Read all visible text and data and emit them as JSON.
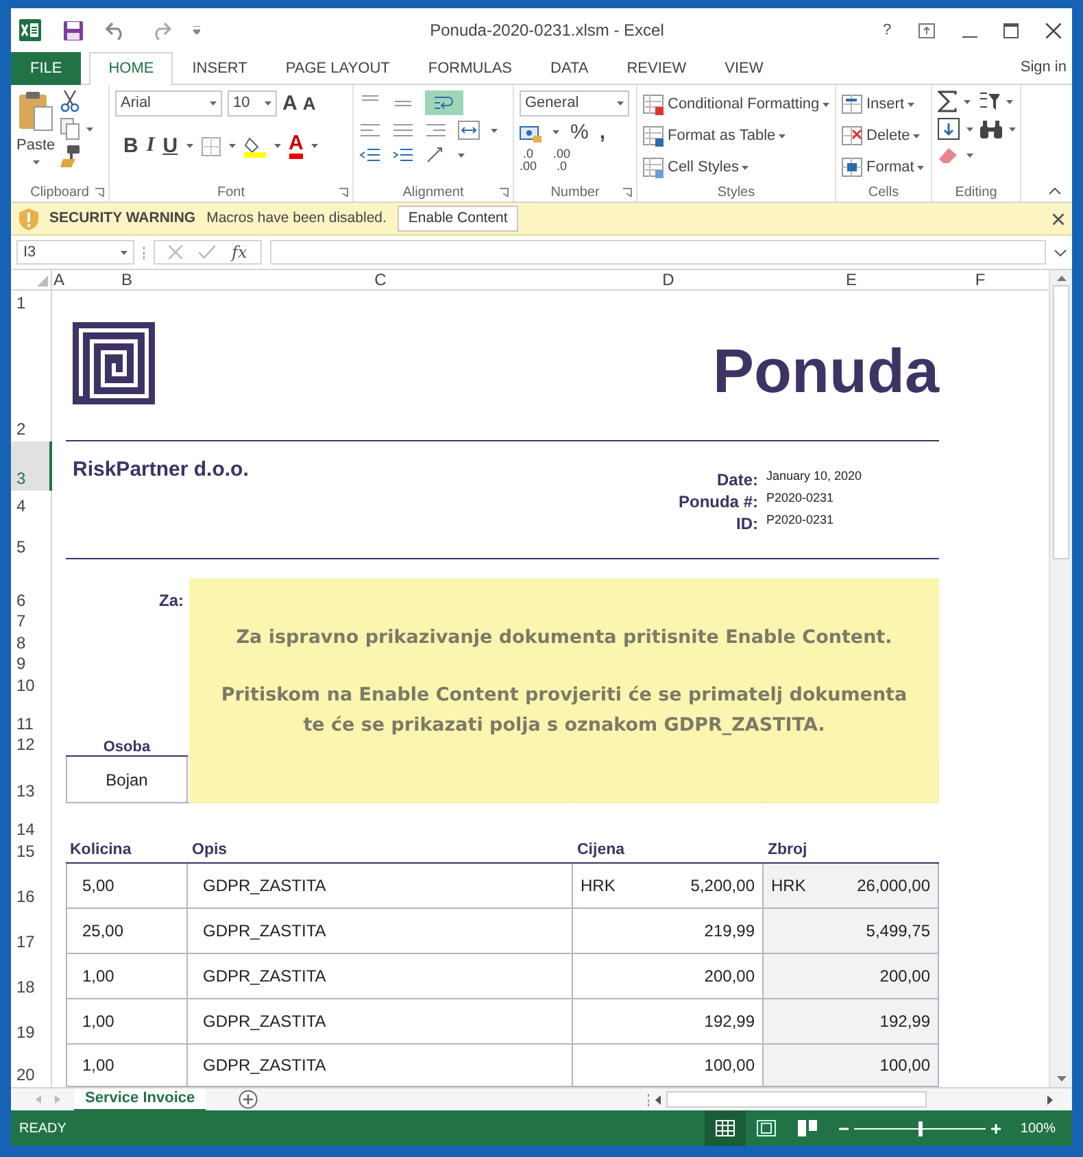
{
  "window": {
    "title": "Ponuda-2020-0231.xlsm - Excel",
    "help": "?",
    "sign_in": "Sign in"
  },
  "ribbon_tabs": [
    {
      "label": "FILE",
      "kind": "file",
      "selected": false
    },
    {
      "label": "HOME",
      "kind": "tab",
      "selected": true
    },
    {
      "label": "INSERT",
      "kind": "tab",
      "selected": false
    },
    {
      "label": "PAGE LAYOUT",
      "kind": "tab",
      "selected": false
    },
    {
      "label": "FORMULAS",
      "kind": "tab",
      "selected": false
    },
    {
      "label": "DATA",
      "kind": "tab",
      "selected": false
    },
    {
      "label": "REVIEW",
      "kind": "tab",
      "selected": false
    },
    {
      "label": "VIEW",
      "kind": "tab",
      "selected": false
    }
  ],
  "ribbon": {
    "groups": [
      {
        "kind": "clipboard",
        "label": "Clipboard",
        "paste": "Paste"
      },
      {
        "kind": "font",
        "label": "Font",
        "font_name": "Arial",
        "font_size": "10",
        "grow": "A",
        "shrink": "A",
        "bold": "B",
        "italic": "I",
        "underline": "U",
        "font_color": "A"
      },
      {
        "kind": "alignment",
        "label": "Alignment",
        "wrap_text_on": true
      },
      {
        "kind": "number",
        "label": "Number",
        "format": "General",
        "percent": "%",
        "comma": ",",
        "decimals": [
          {
            "top": ".0",
            "bottom": ".00"
          },
          {
            "top": ".00",
            "bottom": ".0"
          }
        ]
      },
      {
        "kind": "styles",
        "label": "Styles",
        "buttons": [
          "Conditional Formatting",
          "Format as Table",
          "Cell Styles"
        ]
      },
      {
        "kind": "cells",
        "label": "Cells",
        "buttons": [
          "Insert",
          "Delete",
          "Format"
        ]
      },
      {
        "kind": "editing",
        "label": "Editing"
      }
    ]
  },
  "security_bar": {
    "title": "SECURITY WARNING",
    "message": "Macros have been disabled.",
    "button": "Enable Content"
  },
  "formula_bar": {
    "name_box": "I3",
    "function_label": "fx"
  },
  "columns": [
    "A",
    "B",
    "C",
    "D",
    "E",
    "F"
  ],
  "rows": [
    {
      "label": "1",
      "selected": false
    },
    {
      "label": "2",
      "selected": false
    },
    {
      "label": "3",
      "selected": true
    },
    {
      "label": "4",
      "selected": false
    },
    {
      "label": "5",
      "selected": false
    },
    {
      "label": "6",
      "selected": false
    },
    {
      "label": "7",
      "selected": false
    },
    {
      "label": "8",
      "selected": false
    },
    {
      "label": "9",
      "selected": false
    },
    {
      "label": "10",
      "selected": false
    },
    {
      "label": "11",
      "selected": false
    },
    {
      "label": "12",
      "selected": false
    },
    {
      "label": "13",
      "selected": false
    },
    {
      "label": "14",
      "selected": false
    },
    {
      "label": "15",
      "selected": false
    },
    {
      "label": "16",
      "selected": false
    },
    {
      "label": "17",
      "selected": false
    },
    {
      "label": "18",
      "selected": false
    },
    {
      "label": "19",
      "selected": false
    },
    {
      "label": "20",
      "selected": false
    }
  ],
  "document": {
    "title": "Ponuda",
    "company": "RiskPartner d.o.o.",
    "details": [
      {
        "label": "Date:",
        "value": "January 10, 2020"
      },
      {
        "label": "Ponuda #:",
        "value": "P2020-0231"
      },
      {
        "label": "ID:",
        "value": "P2020-0231"
      }
    ],
    "recipient_label": "Za:",
    "contact": {
      "header": "Osoba",
      "name": "Bojan"
    },
    "notice": [
      "Za ispravno prikazivanje dokumenta pritisnite Enable Content.",
      "Pritiskom na Enable Content provjeriti će se primatelj dokumenta te će se prikazati polja s oznakom GDPR_ZASTITA."
    ],
    "items": {
      "columns": [
        "Kolicina",
        "Opis",
        "Cijena",
        "Zbroj"
      ],
      "rows": [
        {
          "quantity": "5,00",
          "description": "GDPR_ZASTITA",
          "price_currency": "HRK",
          "price": "5,200,00",
          "total_currency": "HRK",
          "total": "26,000,00"
        },
        {
          "quantity": "25,00",
          "description": "GDPR_ZASTITA",
          "price": "219,99",
          "total": "5,499,75"
        },
        {
          "quantity": "1,00",
          "description": "GDPR_ZASTITA",
          "price": "200,00",
          "total": "200,00"
        },
        {
          "quantity": "1,00",
          "description": "GDPR_ZASTITA",
          "price": "192,99",
          "total": "192,99"
        },
        {
          "quantity": "1,00",
          "description": "GDPR_ZASTITA",
          "price": "100,00",
          "total": "100,00"
        }
      ]
    }
  },
  "sheet_tabs": [
    {
      "label": "Service Invoice",
      "selected": true
    }
  ],
  "status_bar": {
    "status": "READY",
    "views": [
      {
        "kind": "normal",
        "selected": true
      },
      {
        "kind": "page_layout",
        "selected": false
      },
      {
        "kind": "page_break",
        "selected": false
      }
    ],
    "zoom": {
      "level": 0.5,
      "reading": "100%"
    }
  }
}
